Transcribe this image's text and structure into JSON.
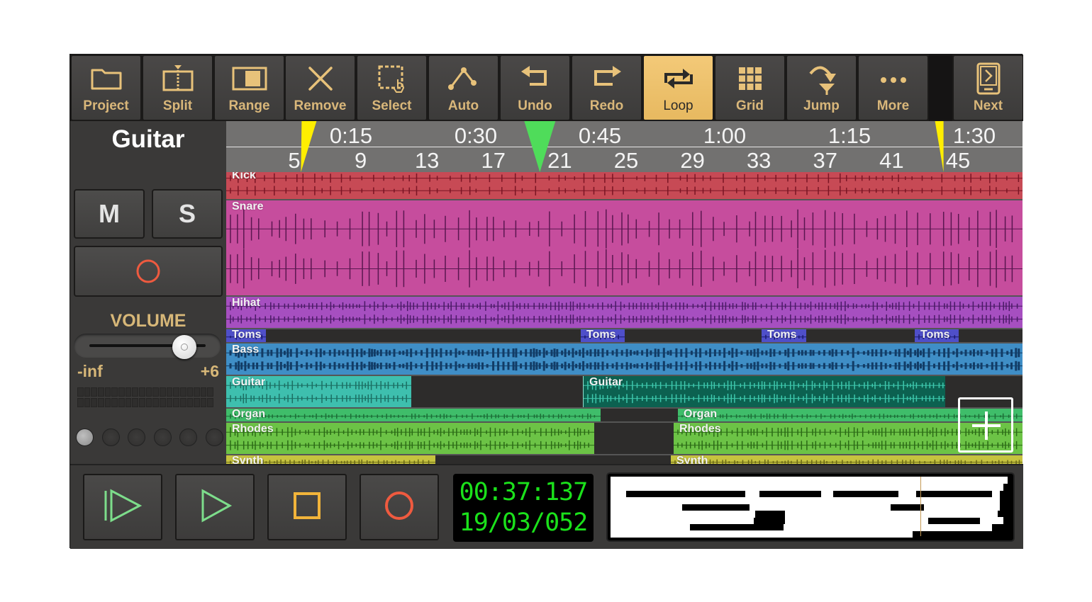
{
  "toolbar": {
    "buttons": [
      {
        "id": "project",
        "label": "Project",
        "icon": "folder-icon"
      },
      {
        "id": "split",
        "label": "Split",
        "icon": "split-icon"
      },
      {
        "id": "range",
        "label": "Range",
        "icon": "range-icon"
      },
      {
        "id": "remove",
        "label": "Remove",
        "icon": "close-icon"
      },
      {
        "id": "select",
        "label": "Select",
        "icon": "select-icon"
      },
      {
        "id": "auto",
        "label": "Auto",
        "icon": "automation-icon"
      },
      {
        "id": "undo",
        "label": "Undo",
        "icon": "undo-icon"
      },
      {
        "id": "redo",
        "label": "Redo",
        "icon": "redo-icon"
      },
      {
        "id": "loop",
        "label": "Loop",
        "icon": "loop-icon",
        "active": true
      },
      {
        "id": "grid",
        "label": "Grid",
        "icon": "grid-icon"
      },
      {
        "id": "jump",
        "label": "Jump",
        "icon": "jump-icon"
      },
      {
        "id": "more",
        "label": "More",
        "icon": "more-icon"
      },
      {
        "id": "next",
        "label": "Next",
        "icon": "next-icon"
      }
    ],
    "accent_color": "#e8c27a",
    "active_color": "#f0c56f"
  },
  "track_panel": {
    "track_name": "Guitar",
    "mute_label": "M",
    "solo_label": "S",
    "record_arm_icon": "record-icon",
    "volume_label": "VOLUME",
    "volume_min_label": "-inf",
    "volume_max_label": "+6",
    "volume_fraction": 0.82,
    "leds_active": [
      true,
      false,
      false,
      false,
      false,
      false
    ]
  },
  "ruler": {
    "time_labels": [
      "0:15",
      "0:30",
      "0:45",
      "1:00",
      "1:15",
      "1:30"
    ],
    "bar_labels": [
      "5",
      "9",
      "13",
      "17",
      "21",
      "25",
      "29",
      "33",
      "37",
      "41",
      "45"
    ],
    "loop_start_bar": 6,
    "loop_end_bar": 44,
    "playhead_bar": 19.8,
    "loop_marker_color": "#ffee00",
    "playhead_color": "#4fdc5a"
  },
  "tracks": [
    {
      "name": "Kick",
      "color": "#c74a55",
      "wave": "#7a1524",
      "regions": [
        {
          "label": "Kick",
          "start": 0,
          "end": 1
        }
      ]
    },
    {
      "name": "Snare",
      "color": "#c64d9d",
      "wave": "#5a1750",
      "regions": [
        {
          "label": "Snare",
          "start": 0,
          "end": 1
        }
      ]
    },
    {
      "name": "Hihat",
      "color": "#a64fc0",
      "wave": "#4a1a66",
      "regions": [
        {
          "label": "Hihat",
          "start": 0,
          "end": 1
        }
      ]
    },
    {
      "name": "Toms",
      "color": "#4f4fc9",
      "wave": "#1a1a70",
      "regions": [
        {
          "label": "Toms",
          "start": 0,
          "end": 0.05
        },
        {
          "label": "Toms",
          "start": 0.445,
          "end": 0.5
        },
        {
          "label": "Toms",
          "start": 0.672,
          "end": 0.728
        },
        {
          "label": "Toms",
          "start": 0.865,
          "end": 0.92
        }
      ]
    },
    {
      "name": "Bass",
      "color": "#3f8ec6",
      "wave": "#123c66",
      "regions": [
        {
          "label": "Bass",
          "start": 0,
          "end": 1
        }
      ]
    },
    {
      "name": "Guitar",
      "color": "#3ebfae",
      "wave": "#1b6e62",
      "regions": [
        {
          "label": "Guitar",
          "start": 0,
          "end": 0.232
        },
        {
          "label": "Guitar",
          "start": 0.448,
          "end": 0.903,
          "selected": true,
          "color": "#0c6150",
          "wave": "#3ec8ad"
        }
      ]
    },
    {
      "name": "Organ",
      "color": "#3fbd6a",
      "wave": "#1c6d36",
      "regions": [
        {
          "label": "Organ",
          "start": 0,
          "end": 0.47
        },
        {
          "label": "Organ",
          "start": 0.567,
          "end": 1
        }
      ]
    },
    {
      "name": "Rhodes",
      "color": "#6cc346",
      "wave": "#2b6a16",
      "regions": [
        {
          "label": "Rhodes",
          "start": 0,
          "end": 0.462
        },
        {
          "label": "Rhodes",
          "start": 0.562,
          "end": 1
        }
      ]
    },
    {
      "name": "Synth",
      "color": "#c6c33f",
      "wave": "#6a6816",
      "regions": [
        {
          "label": "Synth",
          "start": 0,
          "end": 0.263
        },
        {
          "label": "Synth",
          "start": 0.558,
          "end": 1
        }
      ]
    }
  ],
  "add_track_icon": "plus-icon",
  "transport": {
    "buttons": [
      {
        "id": "play-from-start",
        "icon": "play-from-start-icon",
        "color": "#7ddd8b"
      },
      {
        "id": "play",
        "icon": "play-icon",
        "color": "#7ddd8b"
      },
      {
        "id": "stop",
        "icon": "stop-icon",
        "color": "#f2b43a"
      },
      {
        "id": "record",
        "icon": "record-icon",
        "color": "#ef5a3f"
      }
    ],
    "time": "00:37:137",
    "position": "19/03/052",
    "display_color": "#1be11b"
  },
  "overview": {
    "cursor_fraction": 0.78
  }
}
